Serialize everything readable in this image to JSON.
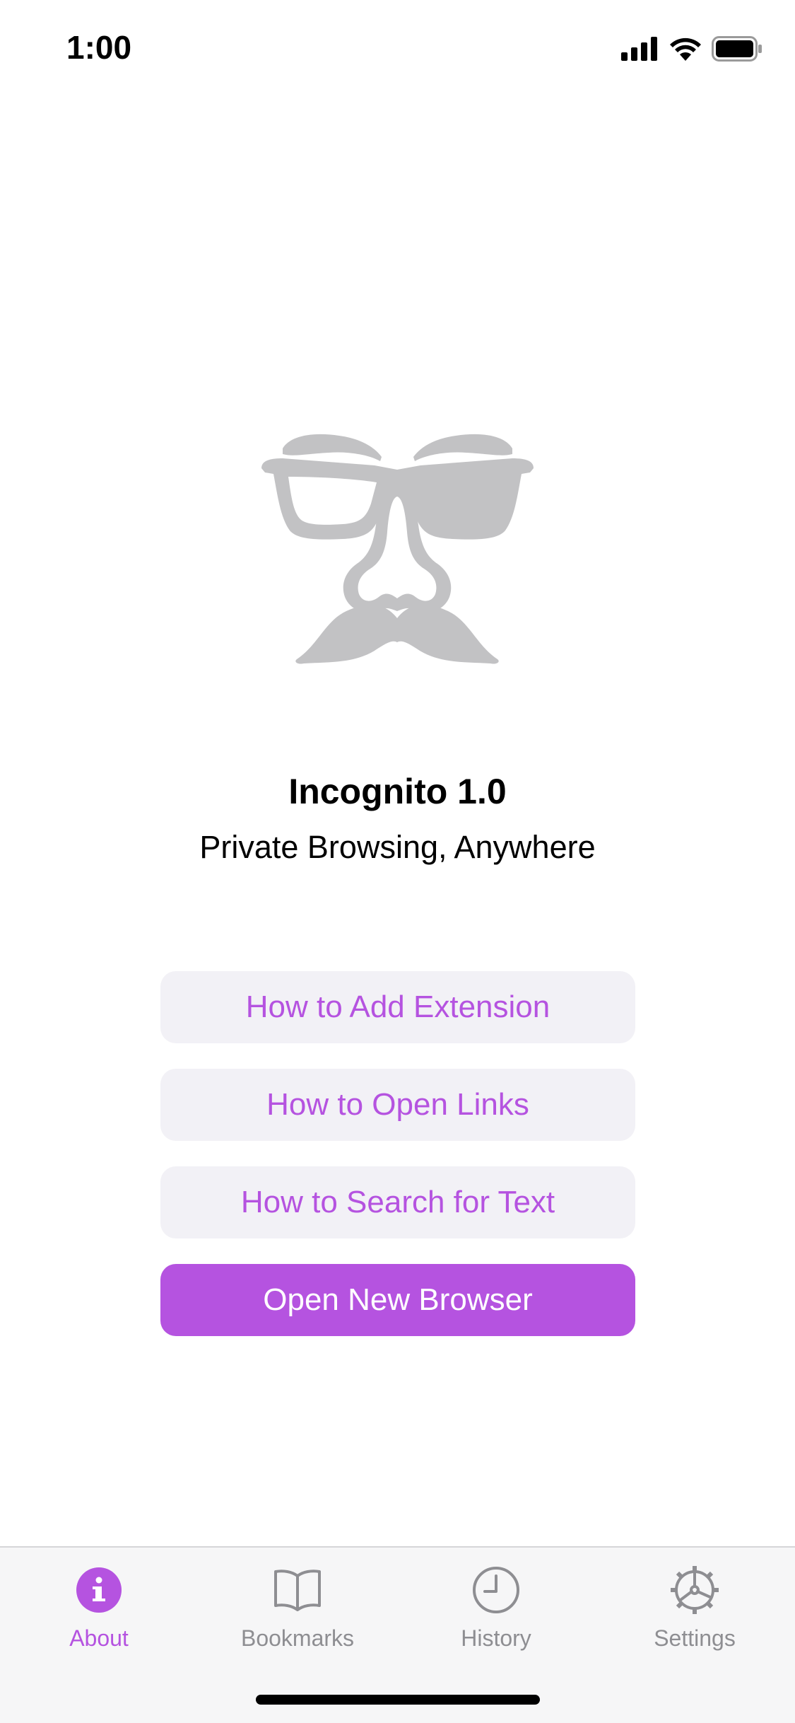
{
  "status_bar": {
    "time": "1:00",
    "icons": [
      "cellular-signal-icon",
      "wifi-icon",
      "battery-icon"
    ]
  },
  "hero": {
    "icon": "disguise-glasses-icon",
    "title": "Incognito 1.0",
    "subtitle": "Private Browsing, Anywhere"
  },
  "actions": {
    "add_extension": "How to Add Extension",
    "open_links": "How to Open Links",
    "search_text": "How to Search for Text",
    "open_browser": "Open New Browser"
  },
  "tab_bar": {
    "tabs": [
      {
        "label": "About",
        "icon": "info-icon",
        "active": true
      },
      {
        "label": "Bookmarks",
        "icon": "book-icon",
        "active": false
      },
      {
        "label": "History",
        "icon": "clock-icon",
        "active": false
      },
      {
        "label": "Settings",
        "icon": "gear-icon",
        "active": false
      }
    ]
  },
  "colors": {
    "accent": "#b553e0",
    "secondary_button_bg": "#f2f1f6",
    "inactive_tab": "#8e8e92",
    "hero_icon": "#c2c2c4"
  }
}
